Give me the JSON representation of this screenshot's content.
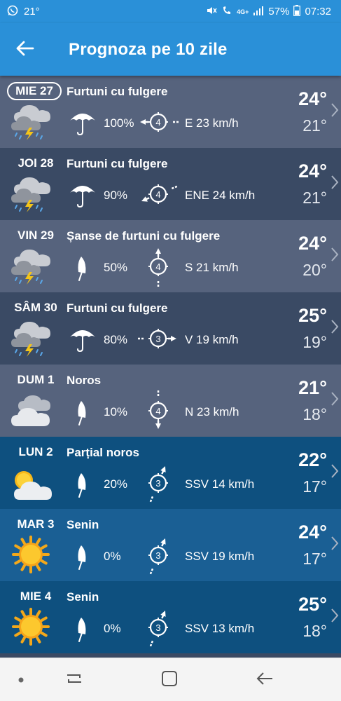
{
  "statusbar": {
    "temp": "21°",
    "battery": "57%",
    "time": "07:32",
    "network": "4G+"
  },
  "appbar": {
    "title": "Prognoza pe 10 zile",
    "back_icon": "arrow-left-icon"
  },
  "colors": {
    "appbar": "#2a90d8",
    "row_light": "#56637d",
    "row_dark": "#3a4a64",
    "row_blue": "#0e507f",
    "row_blue_alt": "#1a5f94"
  },
  "days": [
    {
      "day": "MIE 27",
      "cond": "Furtuni cu fulgere",
      "icon": "thunderstorm-icon",
      "precip": "100%",
      "wind_speed": "4",
      "wind": "E 23 km/h",
      "hi": "24°",
      "lo": "21°"
    },
    {
      "day": "JOI 28",
      "cond": "Furtuni cu fulgere",
      "icon": "thunderstorm-icon",
      "precip": "90%",
      "wind_speed": "4",
      "wind": "ENE 24 km/h",
      "hi": "24°",
      "lo": "21°"
    },
    {
      "day": "VIN 29",
      "cond": "Șanse de furtuni cu fulgere",
      "icon": "thunderstorm-icon",
      "precip": "50%",
      "wind_speed": "4",
      "wind": "S 21 km/h",
      "hi": "24°",
      "lo": "20°"
    },
    {
      "day": "SÂM 30",
      "cond": "Furtuni cu fulgere",
      "icon": "thunderstorm-icon",
      "precip": "80%",
      "wind_speed": "3",
      "wind": "V 19 km/h",
      "hi": "25°",
      "lo": "19°"
    },
    {
      "day": "DUM 1",
      "cond": "Noros",
      "icon": "cloud-icon",
      "precip": "10%",
      "wind_speed": "4",
      "wind": "N 23 km/h",
      "hi": "21°",
      "lo": "18°"
    },
    {
      "day": "LUN 2",
      "cond": "Parțial noros",
      "icon": "partly-cloudy-icon",
      "precip": "20%",
      "wind_speed": "3",
      "wind": "SSV 14 km/h",
      "hi": "22°",
      "lo": "17°"
    },
    {
      "day": "MAR 3",
      "cond": "Senin",
      "icon": "sun-icon",
      "precip": "0%",
      "wind_speed": "3",
      "wind": "SSV 19 km/h",
      "hi": "24°",
      "lo": "17°"
    },
    {
      "day": "MIE 4",
      "cond": "Senin",
      "icon": "sun-icon",
      "precip": "0%",
      "wind_speed": "3",
      "wind": "SSV 13 km/h",
      "hi": "25°",
      "lo": "18°"
    }
  ],
  "navbar": {
    "recent_icon": "recent-apps-icon",
    "home_icon": "home-icon",
    "back_icon": "back-icon"
  }
}
